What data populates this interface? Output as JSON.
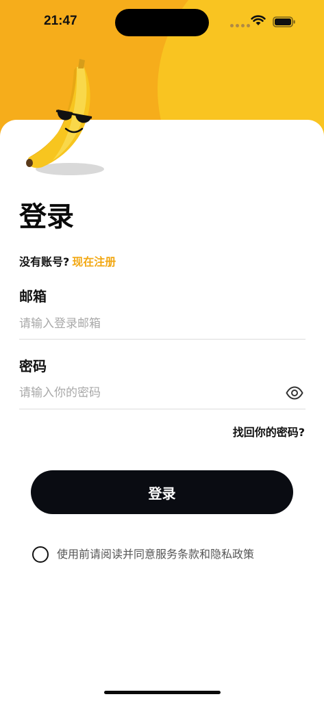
{
  "status_bar": {
    "time": "21:47"
  },
  "login": {
    "title": "登录",
    "no_account": "没有账号?",
    "register_link": "现在注册",
    "email_label": "邮箱",
    "email_placeholder": "请输入登录邮箱",
    "email_value": "",
    "password_label": "密码",
    "password_placeholder": "请输入你的密码",
    "password_value": "",
    "forgot_password": "找回你的密码?",
    "login_button": "登录",
    "agreement": "使用前请阅读并同意服务条款和隐私政策",
    "agreement_checked": false
  },
  "colors": {
    "brand_yellow": "#f6ad1b",
    "accent_link": "#f2a814",
    "button_dark": "#0a0c12"
  },
  "icons": {
    "mascot": "banana-sunglasses-icon",
    "password_toggle": "eye-icon",
    "wifi": "wifi-icon",
    "battery": "battery-icon"
  }
}
